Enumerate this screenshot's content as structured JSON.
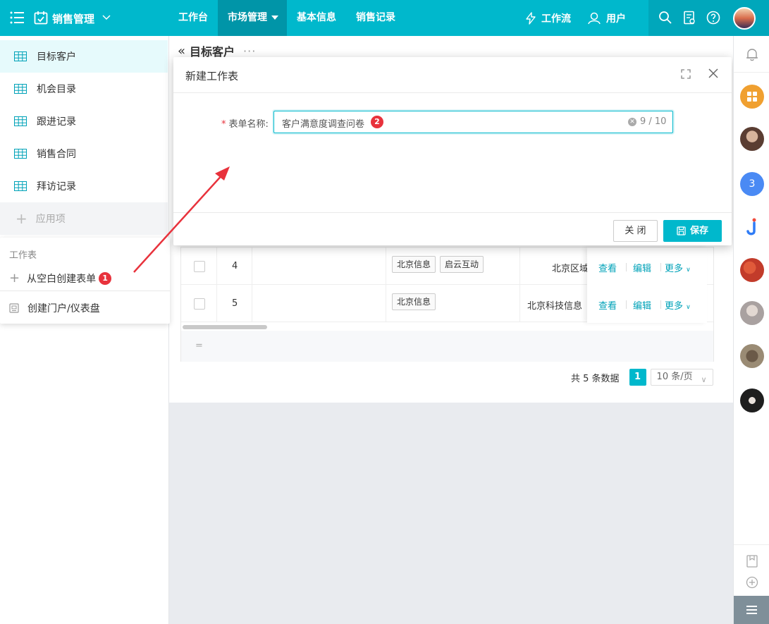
{
  "topbar": {
    "app_title": "销售管理",
    "nav": [
      {
        "label": "工作台"
      },
      {
        "label": "市场管理"
      },
      {
        "label": "基本信息"
      },
      {
        "label": "销售记录"
      }
    ],
    "workflow_label": "工作流",
    "users_label": "用户"
  },
  "sidebar": {
    "items": [
      {
        "label": "目标客户"
      },
      {
        "label": "机会目录"
      },
      {
        "label": "跟进记录"
      },
      {
        "label": "销售合同"
      },
      {
        "label": "拜访记录"
      }
    ],
    "add_label": "应用项"
  },
  "popmenu": {
    "header": "工作表",
    "create_blank": "从空白创建表单",
    "create_blank_badge": "1",
    "create_portal": "创建门户/仪表盘"
  },
  "page": {
    "title": "目标客户",
    "more": "···"
  },
  "table": {
    "rows": [
      {
        "num": "4",
        "tags": [
          "北京信息",
          "启云互动"
        ],
        "addr": "北京区域"
      },
      {
        "num": "5",
        "tags": [
          "北京信息"
        ],
        "addr": "北京科技信息"
      }
    ],
    "view_label": "查看",
    "edit_label": "编辑",
    "more_label": "更多",
    "footer_symbol": "="
  },
  "pager": {
    "total_text": "共 5 条数据",
    "current_page": "1",
    "page_size": "10 条/页"
  },
  "modal": {
    "title": "新建工作表",
    "field_label": "表单名称:",
    "field_value": "客户满意度调查问卷",
    "field_badge": "2",
    "char_count": "9 / 10",
    "close_label": "关 闭",
    "save_label": "保存"
  },
  "rail": {
    "badge_number": "3"
  },
  "colors": {
    "accent": "#00b8cc",
    "badge_red": "#e8323c"
  }
}
